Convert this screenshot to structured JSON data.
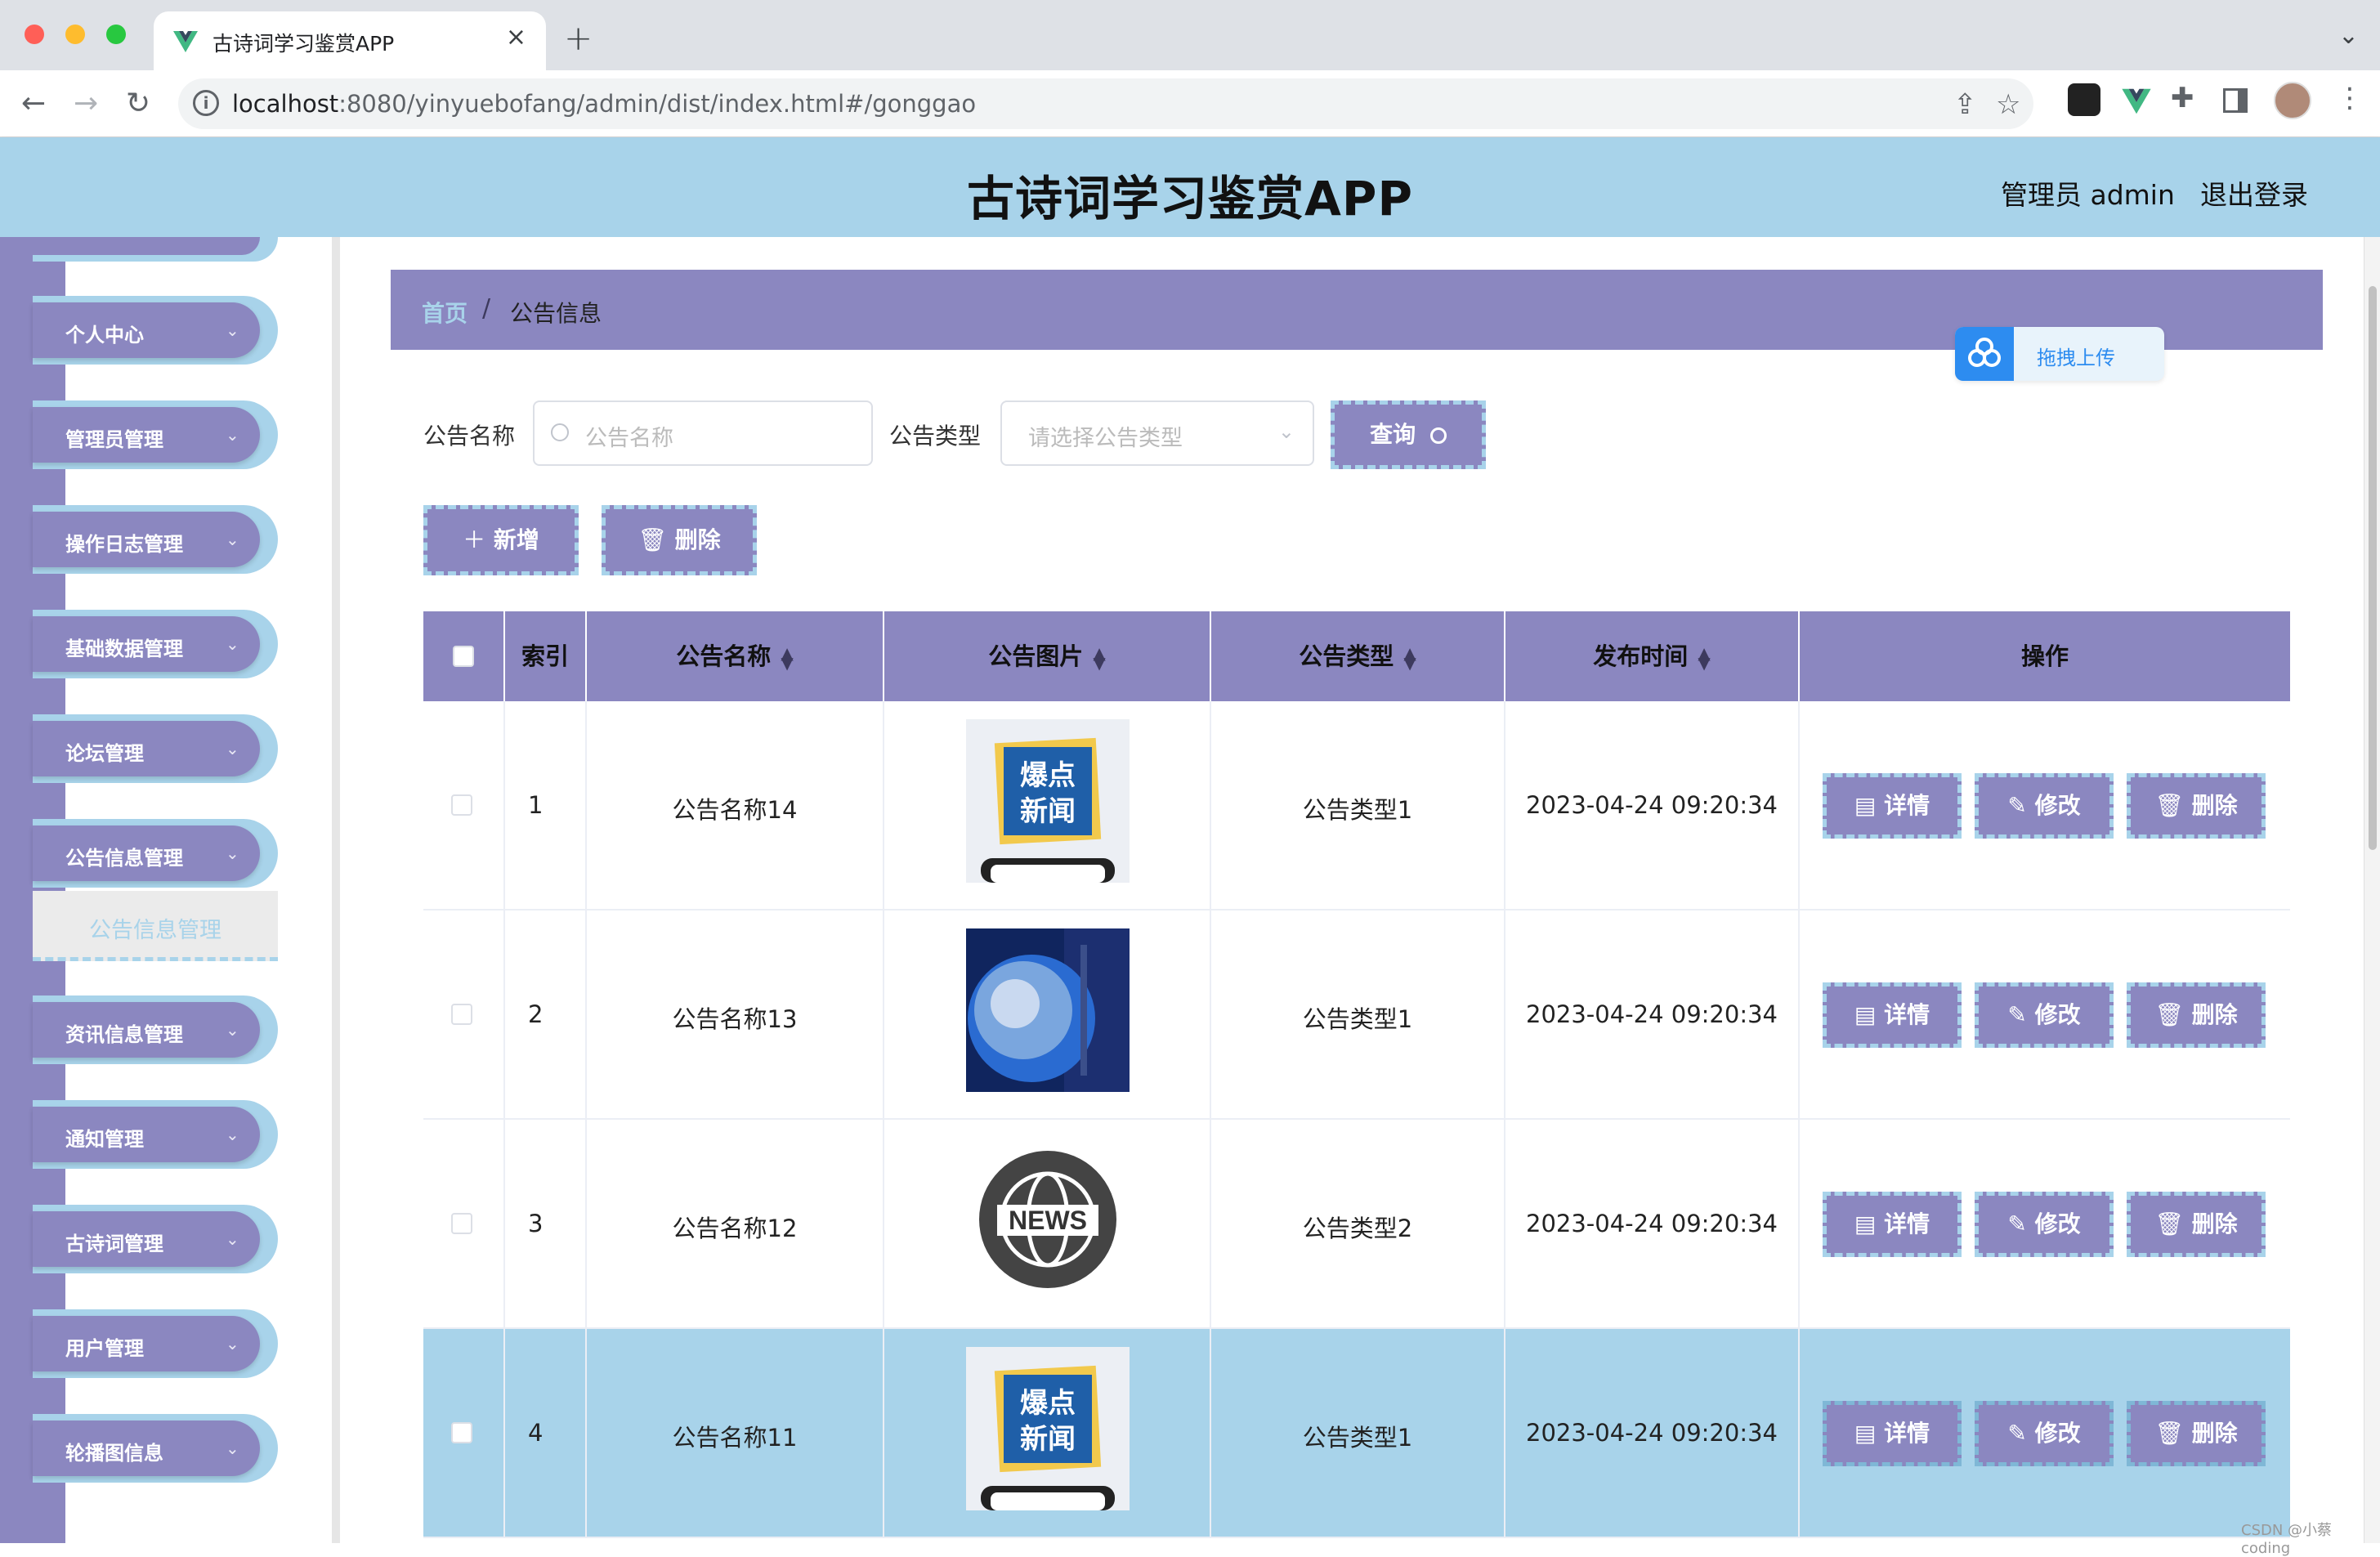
{
  "browser": {
    "tab_title": "古诗词学习鉴赏APP",
    "url_host": "localhost",
    "url_rest": ":8080/yinyuebofang/admin/dist/index.html#/gonggao"
  },
  "header": {
    "title": "古诗词学习鉴赏APP",
    "user": "管理员 admin",
    "logout": "退出登录"
  },
  "sidebar": {
    "items": [
      {
        "label": "个人中心"
      },
      {
        "label": "管理员管理"
      },
      {
        "label": "操作日志管理"
      },
      {
        "label": "基础数据管理"
      },
      {
        "label": "论坛管理"
      },
      {
        "label": "公告信息管理"
      },
      {
        "label": "资讯信息管理"
      },
      {
        "label": "通知管理"
      },
      {
        "label": "古诗词管理"
      },
      {
        "label": "用户管理"
      },
      {
        "label": "轮播图信息"
      }
    ],
    "active_sub": "公告信息管理"
  },
  "breadcrumb": {
    "home": "首页",
    "separator": "/",
    "current": "公告信息"
  },
  "upload": {
    "label": "拖拽上传"
  },
  "filters": {
    "name_label": "公告名称",
    "name_placeholder": "公告名称",
    "type_label": "公告类型",
    "type_placeholder": "请选择公告类型",
    "query_button": "查询"
  },
  "actions": {
    "add": "新增",
    "delete": "删除"
  },
  "table": {
    "columns": [
      "索引",
      "公告名称",
      "公告图片",
      "公告类型",
      "发布时间",
      "操作"
    ],
    "rows": [
      {
        "index": "1",
        "name": "公告名称14",
        "image": "breaking-news-phone",
        "type": "公告类型1",
        "time": "2023-04-24 09:20:34"
      },
      {
        "index": "2",
        "name": "公告名称13",
        "image": "globe-news",
        "type": "公告类型1",
        "time": "2023-04-24 09:20:34"
      },
      {
        "index": "3",
        "name": "公告名称12",
        "image": "news-globe-badge",
        "type": "公告类型2",
        "time": "2023-04-24 09:20:34"
      },
      {
        "index": "4",
        "name": "公告名称11",
        "image": "breaking-news-phone",
        "type": "公告类型1",
        "time": "2023-04-24 09:20:34"
      }
    ],
    "row_actions": {
      "detail": "详情",
      "edit": "修改",
      "delete": "删除"
    },
    "badge_text_1": "爆点",
    "badge_text_2": "新闻",
    "news_text": "NEWS"
  },
  "watermark": "CSDN @小蔡coding",
  "colors": {
    "accent": "#8b87c0",
    "light": "#a8d3ea",
    "link": "#2d8cf0"
  }
}
